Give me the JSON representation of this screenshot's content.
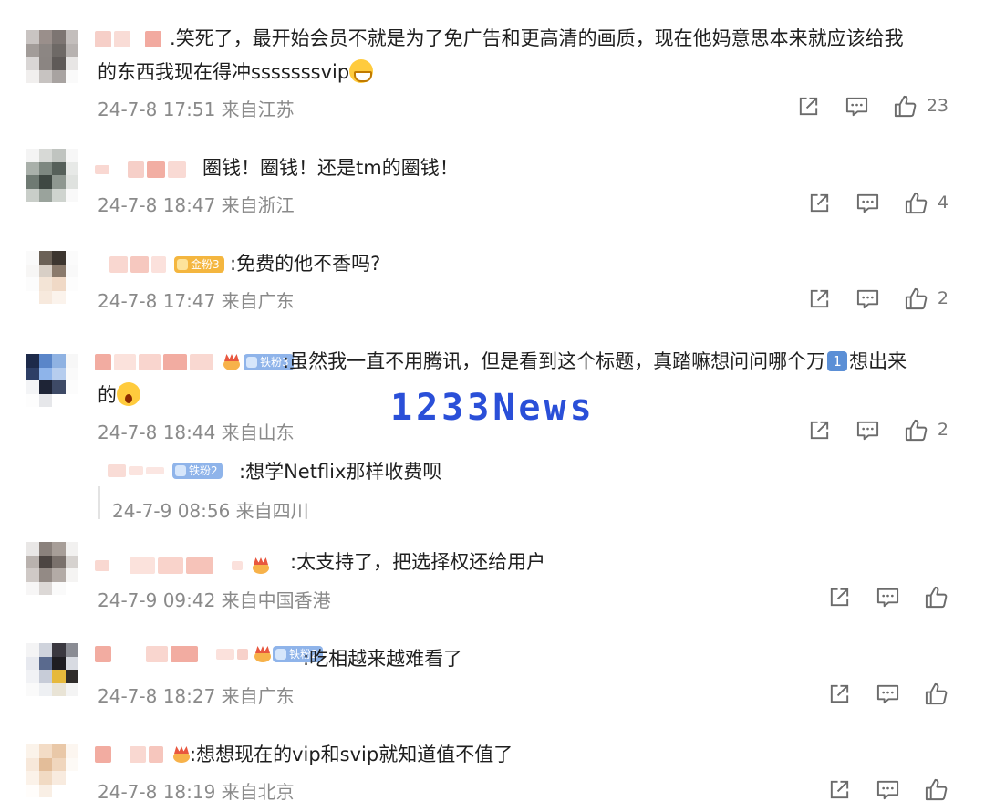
{
  "watermark": "1233News",
  "icons": {
    "share": "share-icon",
    "comment": "comment-icon",
    "like": "thumbs-up-icon"
  },
  "colors": {
    "meta_text": "#8a8a8a",
    "iron_badge": "#8fb4ea",
    "gold_badge": "#f4b63f",
    "watermark": "#2a4fd8"
  },
  "comments": [
    {
      "prefix": ".",
      "text_line1": "笑死了，最开始会员不就是为了免广告和更高清的画质，现在他妈意思本来就应该给我",
      "text_line2": "的东西我现在得冲sssssssvip",
      "meta": "24-7-8 17:51 来自江苏",
      "likes": "23"
    },
    {
      "text": "圈钱！圈钱！还是tm的圈钱！",
      "meta": "24-7-8 18:47 来自浙江",
      "likes": "4"
    },
    {
      "badge": "金粉3",
      "text": ":免费的他不香吗?",
      "meta": "24-7-8 17:47 来自广东",
      "likes": "2"
    },
    {
      "badge": "铁粉3",
      "text_line1a": ":虽然我一直不用腾讯，但是看到这个标题，真踏嘛想问问哪个万",
      "num_icon": "1",
      "text_line1b": "想出来",
      "text_line2": "的",
      "meta": "24-7-8 18:44 来自山东",
      "likes": "2"
    },
    {
      "badge": "铁粉2",
      "text": ":想学Netflix那样收费呗",
      "meta": "24-7-9 08:56 来自四川"
    },
    {
      "text": ":太支持了，把选择权还给用户",
      "meta": "24-7-9 09:42 来自中国香港"
    },
    {
      "badge": "铁粉2",
      "text": ":吃相越来越难看了",
      "meta": "24-7-8 18:27 来自广东"
    },
    {
      "text": ":想想现在的vip和svip就知道值不值了",
      "meta": "24-7-8 18:19 来自北京"
    }
  ]
}
